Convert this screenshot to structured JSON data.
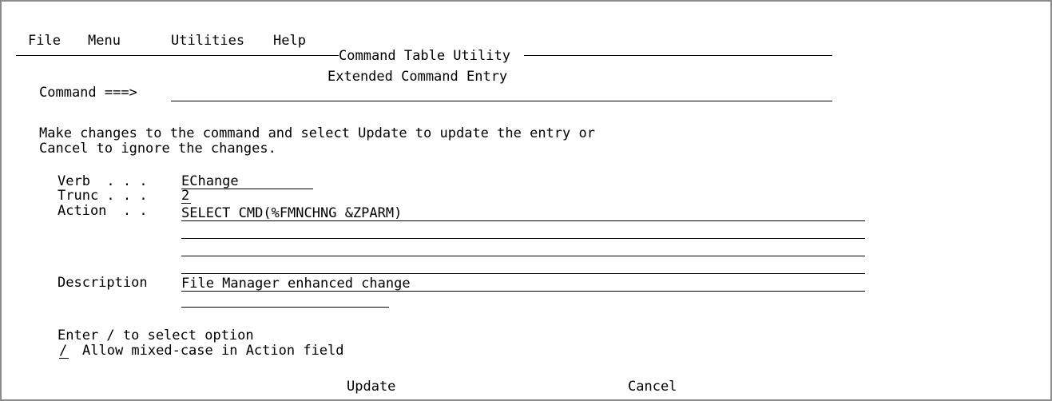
{
  "menubar": {
    "file": "File",
    "menu": "Menu",
    "utilities": "Utilities",
    "help": "Help"
  },
  "panel": {
    "title": "Command Table Utility",
    "subtitle": "Extended Command Entry"
  },
  "command": {
    "label": "Command ===>",
    "value": ""
  },
  "instructions": {
    "line1": "Make changes to the command and select Update to update the entry or",
    "line2": "Cancel to ignore the changes."
  },
  "fields": {
    "verb_label": "Verb  . . .",
    "verb_value": "EChange",
    "trunc_label": "Trunc . . .",
    "trunc_value": "2",
    "action_label": "Action  . .",
    "action_line1": "SELECT CMD(%FMNCHNG &ZPARM)",
    "action_line2": "",
    "action_line3": "",
    "action_line4": "",
    "description_label": "Description",
    "description_line1": "File Manager enhanced change",
    "description_line2": ""
  },
  "options": {
    "header": "Enter / to select option",
    "mixed_case_value": "/",
    "mixed_case_label": "Allow mixed-case in Action field"
  },
  "buttons": {
    "update": "Update",
    "cancel": "Cancel"
  }
}
